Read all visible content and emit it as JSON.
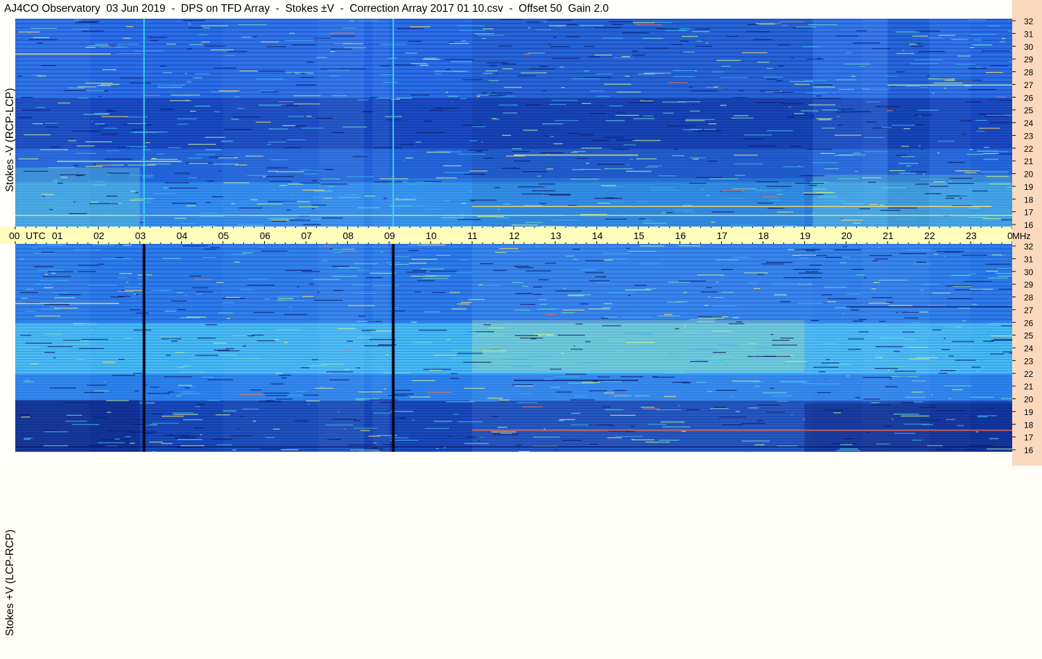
{
  "title": "AJ4CO Observatory  03 Jun 2019  -  DPS on TFD Array  -  Stokes ±V  -  Correction Array 2017 01 10.csv  -  Offset 50  Gain 2.0",
  "chart_data": [
    {
      "type": "heatmap",
      "name_label": "Stokes -V (RCP-LCP)",
      "ylabel": "Stokes -V (RCP-LCP)",
      "x_unit": "UTC",
      "y_unit": "MHz",
      "x_ticks": [
        "00",
        "01",
        "02",
        "03",
        "04",
        "05",
        "06",
        "07",
        "08",
        "09",
        "10",
        "11",
        "12",
        "13",
        "14",
        "15",
        "16",
        "17",
        "18",
        "19",
        "20",
        "21",
        "22",
        "23",
        "00"
      ],
      "y_ticks": [
        32,
        31,
        30,
        29,
        28,
        27,
        26,
        25,
        24,
        23,
        22,
        21,
        20,
        19,
        18,
        17,
        16
      ],
      "ylim": [
        16,
        32
      ],
      "xlim_hours": [
        0,
        24
      ],
      "vertical_lines_hours": [
        3.1,
        9.1
      ],
      "colormap": [
        "#0a1a6e",
        "#1237b8",
        "#1a5ee0",
        "#2d86f2",
        "#3fb0f0",
        "#6ad8d0",
        "#c8f090",
        "#ffe060",
        "#ff7040"
      ]
    },
    {
      "type": "heatmap",
      "name_label": "Stokes +V (LCP-RCP)",
      "ylabel": "Stokes +V (LCP-RCP)",
      "x_unit": "UTC",
      "y_unit": "MHz",
      "x_ticks": [
        "00",
        "01",
        "02",
        "03",
        "04",
        "05",
        "06",
        "07",
        "08",
        "09",
        "10",
        "11",
        "12",
        "13",
        "14",
        "15",
        "16",
        "17",
        "18",
        "19",
        "20",
        "21",
        "22",
        "23",
        "00"
      ],
      "y_ticks": [
        32,
        31,
        30,
        29,
        28,
        27,
        26,
        25,
        24,
        23,
        22,
        21,
        20,
        19,
        18,
        17,
        16
      ],
      "ylim": [
        16,
        32
      ],
      "xlim_hours": [
        0,
        24
      ],
      "vertical_lines_hours": [
        3.1,
        9.1
      ],
      "colormap": [
        "#0a1a6e",
        "#1237b8",
        "#1a5ee0",
        "#2d86f2",
        "#3fb0f0",
        "#6ad8d0",
        "#c8f090",
        "#ffe060",
        "#ff7040"
      ]
    }
  ],
  "axis": {
    "utc_label": "UTC",
    "mhz_label": "MHz"
  }
}
